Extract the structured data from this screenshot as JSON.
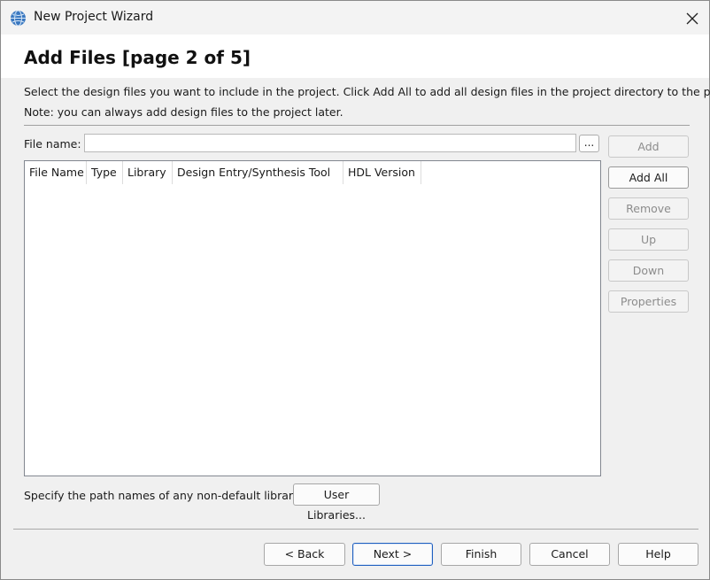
{
  "window": {
    "title": "New Project Wizard"
  },
  "header": {
    "title": "Add Files [page 2 of 5]"
  },
  "description": {
    "line1": "Select the design files you want to include in the project. Click Add All to add all design files in the project directory to the project.",
    "line2": "Note: you can always add design files to the project later."
  },
  "file_name": {
    "label": "File name:",
    "value": "",
    "browse_label": "..."
  },
  "table": {
    "columns": [
      "File Name",
      "Type",
      "Library",
      "Design Entry/Synthesis Tool",
      "HDL Version"
    ],
    "rows": []
  },
  "side_buttons": {
    "add": "Add",
    "add_all": "Add All",
    "remove": "Remove",
    "up": "Up",
    "down": "Down",
    "properties": "Properties"
  },
  "libraries": {
    "label": "Specify the path names of any non-default libraries.",
    "button": "User Libraries..."
  },
  "footer": {
    "back": "< Back",
    "next": "Next >",
    "finish": "Finish",
    "cancel": "Cancel",
    "help": "Help"
  },
  "icons": {
    "app": "globe-icon",
    "close": "close-icon"
  }
}
